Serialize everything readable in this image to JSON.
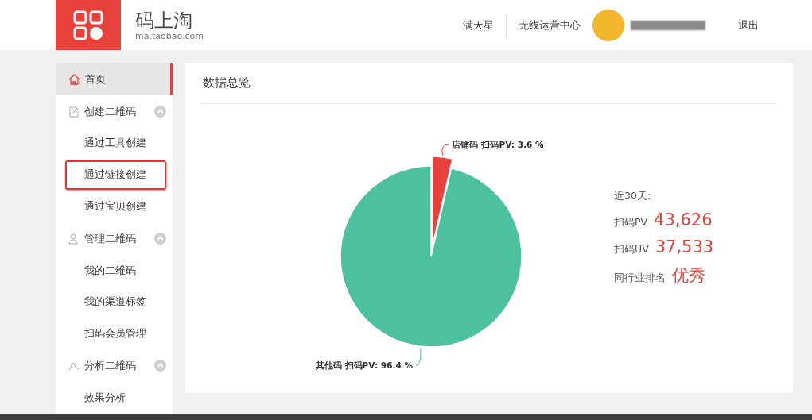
{
  "header": {
    "logo_title": "码上淘",
    "logo_subtitle": "ma.taobao.com",
    "nav": [
      "满天星",
      "无线运营中心"
    ],
    "user": {
      "name_redacted": true
    },
    "logout": "退出"
  },
  "sidebar": {
    "home": {
      "label": "首页",
      "selected": true
    },
    "groups": [
      {
        "label": "创建二维码",
        "expanded": true,
        "items": [
          {
            "label": "通过工具创建",
            "highlighted": false
          },
          {
            "label": "通过链接创建",
            "highlighted": true
          },
          {
            "label": "通过宝贝创建",
            "highlighted": false
          }
        ]
      },
      {
        "label": "管理二维码",
        "expanded": true,
        "items": [
          {
            "label": "我的二维码",
            "highlighted": false
          },
          {
            "label": "我的渠道标签",
            "highlighted": false
          },
          {
            "label": "扫码会员管理",
            "highlighted": false
          }
        ]
      },
      {
        "label": "分析二维码",
        "expanded": true,
        "items": [
          {
            "label": "效果分析",
            "highlighted": false
          }
        ]
      }
    ]
  },
  "overview": {
    "title": "数据总览",
    "chart_data": {
      "type": "pie",
      "categories": [
        "店铺码",
        "其他码"
      ],
      "colors": [
        "#e8403a",
        "#4cc09f"
      ],
      "series": [
        {
          "name": "扫码PV",
          "values": [
            3.6,
            96.4
          ]
        }
      ],
      "value_labels": [
        ": 3.6 %",
        ": 96.4 %"
      ]
    },
    "period": "近30天:",
    "stats": [
      {
        "label": "扫码PV",
        "value": "43,626"
      },
      {
        "label": "扫码UV",
        "value": "37,533"
      },
      {
        "label": "同行业排名",
        "value": "优秀"
      }
    ]
  }
}
